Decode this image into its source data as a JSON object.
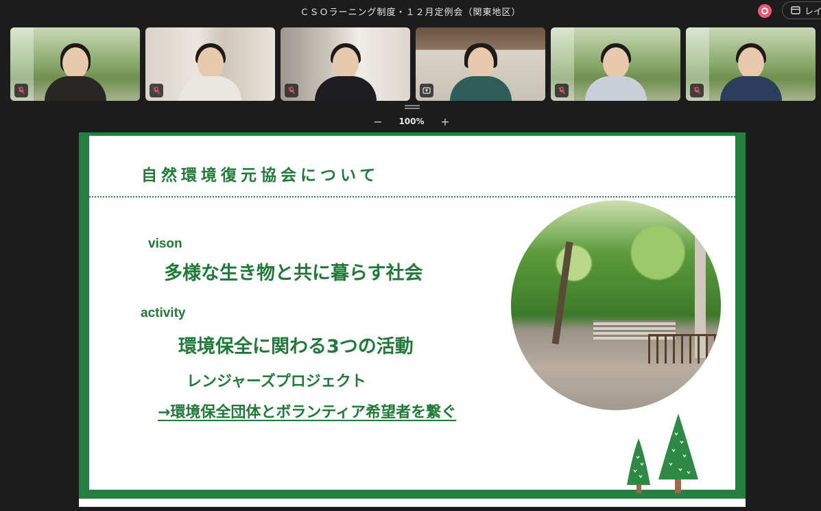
{
  "window": {
    "title": "ＣＳＯラーニング制度・１２月定例会（関東地区）",
    "layout_button_label": "レイ"
  },
  "participants": [
    {
      "mic": "muted"
    },
    {
      "mic": "muted"
    },
    {
      "mic": "muted"
    },
    {
      "mic": "sharing"
    },
    {
      "mic": "muted"
    },
    {
      "mic": "muted"
    }
  ],
  "zoom": {
    "minus": "−",
    "value": "100%",
    "plus": "+"
  },
  "slide": {
    "title": "自然環境復元協会について",
    "vision_label": "vison",
    "vision_text": "多様な生き物と共に暮らす社会",
    "activity_label": "activity",
    "activity_text": "環境保全に関わる3つの活動",
    "project_name": "レンジャーズプロジェクト",
    "project_desc": "→環境保全団体とボランティア希望者を繋ぐ",
    "accent_color": "#1f7a38",
    "border_color": "#23803e"
  }
}
